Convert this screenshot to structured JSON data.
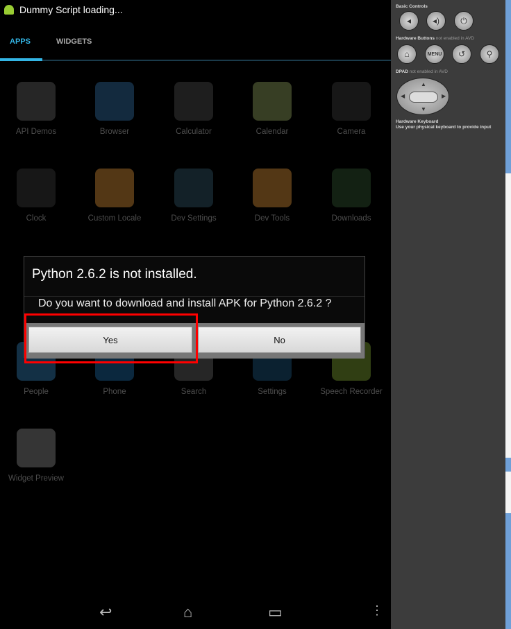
{
  "status_bar": {
    "title": "Dummy Script loading..."
  },
  "tabs": [
    {
      "label": "APPS",
      "active": true
    },
    {
      "label": "WIDGETS",
      "active": false
    }
  ],
  "apps": [
    {
      "label": "API Demos",
      "icon": "folder-gear-icon",
      "color": "#555"
    },
    {
      "label": "Browser",
      "icon": "globe-icon",
      "color": "#2a5d8a"
    },
    {
      "label": "Calculator",
      "icon": "calculator-icon",
      "color": "#444"
    },
    {
      "label": "Calendar",
      "icon": "calendar-icon",
      "color": "#7a8a50"
    },
    {
      "label": "Camera",
      "icon": "camera-icon",
      "color": "#333"
    },
    {
      "label": "Clock",
      "icon": "clock-icon",
      "color": "#333"
    },
    {
      "label": "Custom Locale",
      "icon": "gear-icon",
      "color": "#b87a30"
    },
    {
      "label": "Dev Settings",
      "icon": "sliders-icon",
      "color": "#2a4a5a"
    },
    {
      "label": "Dev Tools",
      "icon": "gear-icon",
      "color": "#b87a30"
    },
    {
      "label": "Downloads",
      "icon": "download-icon",
      "color": "#2a4a2a"
    },
    {
      "label": "People",
      "icon": "contact-icon",
      "color": "#2a6a9a"
    },
    {
      "label": "Phone",
      "icon": "phone-icon",
      "color": "#1a5a8a"
    },
    {
      "label": "Search",
      "icon": "magnifier-icon",
      "color": "#555"
    },
    {
      "label": "Settings",
      "icon": "sliders-icon",
      "color": "#1a4a6a"
    },
    {
      "label": "Speech Recorder",
      "icon": "android-icon",
      "color": "#6a8a2a"
    },
    {
      "label": "Widget Preview",
      "icon": "widget-icon",
      "color": "#777"
    }
  ],
  "dialog": {
    "title": "Python 2.6.2 is not installed.",
    "message": "Do you want to download and install APK for Python 2.6.2 ?",
    "yes": "Yes",
    "no": "No"
  },
  "nav": {
    "back": "↩",
    "home": "⌂",
    "recents": "▭",
    "menu": "⋮"
  },
  "side": {
    "basic_controls": "Basic Controls",
    "hardware_buttons": "Hardware Buttons",
    "hw_note": "not enabled in AVD",
    "dpad": "DPAD",
    "dpad_note": "not enabled in AVD",
    "keyboard": "Hardware Keyboard",
    "keyboard_note": "Use your physical keyboard to provide input",
    "menu_label": "MENU"
  }
}
